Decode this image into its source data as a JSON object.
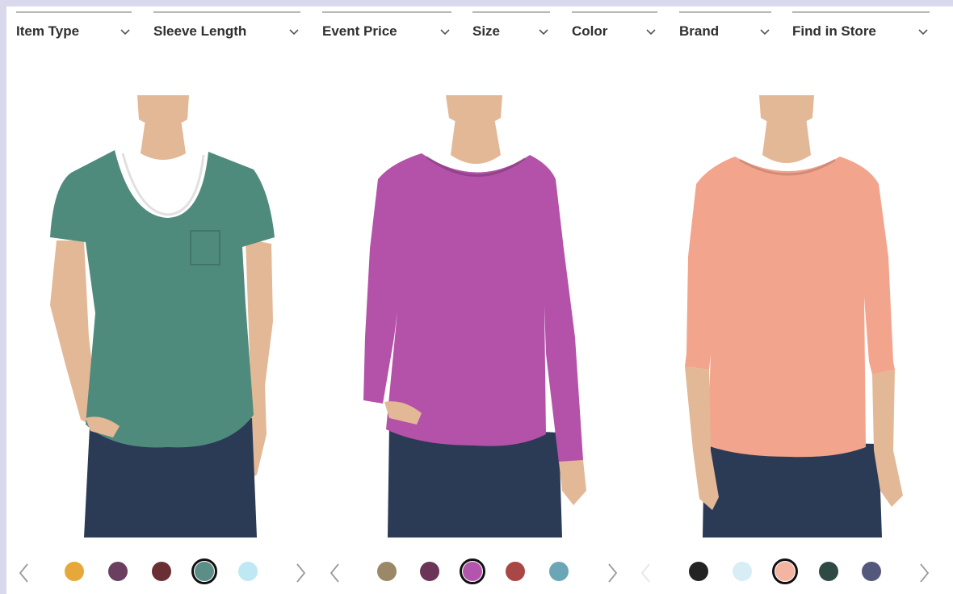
{
  "filters": [
    {
      "label": "Item Type"
    },
    {
      "label": "Sleeve Length"
    },
    {
      "label": "Event Price"
    },
    {
      "label": "Size"
    },
    {
      "label": "Color"
    },
    {
      "label": "Brand"
    },
    {
      "label": "Find in Store"
    }
  ],
  "products": [
    {
      "shirt_color": "#4f8b7d",
      "swatches": [
        "#e6a83a",
        "#6b3f5f",
        "#6a2f33",
        "#5c8e88",
        "#bfe8f4"
      ],
      "selected_swatch": 3
    },
    {
      "shirt_color": "#b352a8",
      "swatches": [
        "#9a8866",
        "#6a3556",
        "#b455ad",
        "#a84745",
        "#6aa6b5"
      ],
      "selected_swatch": 2
    },
    {
      "shirt_color": "#f3a48c",
      "swatches": [
        "#232323",
        "#d8eef6",
        "#f4b4a2",
        "#2f4a45",
        "#54587a"
      ],
      "selected_swatch": 2
    }
  ],
  "colors": {
    "skin": "#e3b896",
    "jeans": "#2b3a55",
    "hair": "#6b4a35",
    "arrow": "#9a9a9a",
    "arrow_disabled": "#e6e6e6"
  }
}
